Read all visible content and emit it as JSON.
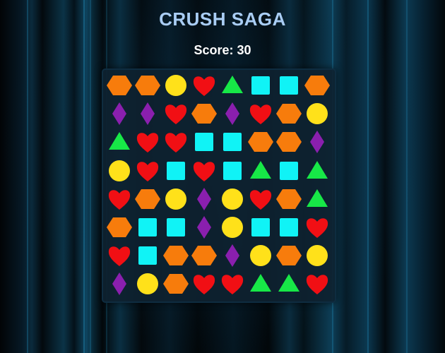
{
  "game": {
    "title": "CRUSH SAGA",
    "score_text": "Score: 30"
  },
  "colors": {
    "hexagon": "#f77c0c",
    "circle": "#ffe11a",
    "heart": "#f10f14",
    "triangle": "#17e847",
    "square": "#10f3f6",
    "diamond": "#8a1fae"
  },
  "board": {
    "rows": 8,
    "cols": 8,
    "grid": [
      [
        "hexagon",
        "hexagon",
        "circle",
        "heart",
        "triangle",
        "square",
        "square",
        "hexagon"
      ],
      [
        "diamond",
        "diamond",
        "heart",
        "hexagon",
        "diamond",
        "heart",
        "hexagon",
        "circle"
      ],
      [
        "triangle",
        "heart",
        "heart",
        "square",
        "square",
        "hexagon",
        "hexagon",
        "diamond"
      ],
      [
        "circle",
        "heart",
        "square",
        "heart",
        "square",
        "triangle",
        "square",
        "triangle"
      ],
      [
        "heart",
        "hexagon",
        "circle",
        "diamond",
        "circle",
        "heart",
        "hexagon",
        "triangle"
      ],
      [
        "hexagon",
        "square",
        "square",
        "diamond",
        "circle",
        "square",
        "square",
        "heart"
      ],
      [
        "heart",
        "square",
        "hexagon",
        "hexagon",
        "diamond",
        "circle",
        "hexagon",
        "circle"
      ],
      [
        "diamond",
        "circle",
        "hexagon",
        "heart",
        "heart",
        "triangle",
        "triangle",
        "heart"
      ]
    ]
  }
}
